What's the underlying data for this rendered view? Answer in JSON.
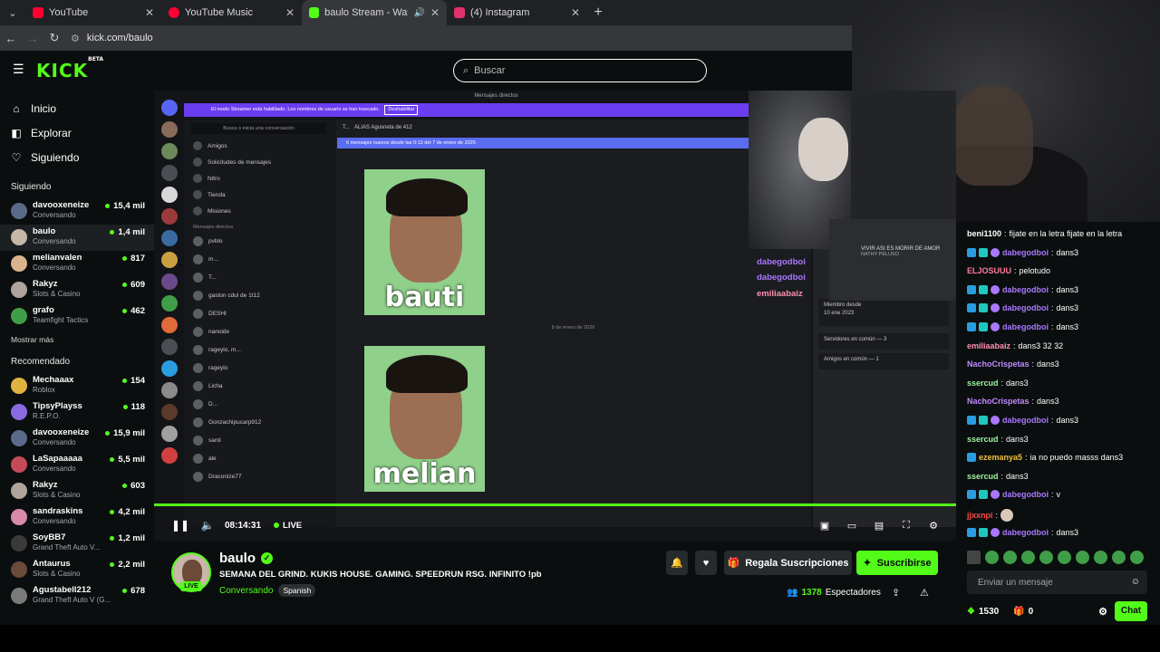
{
  "browser": {
    "tabs": [
      {
        "title": "YouTube",
        "color": "#ff0033"
      },
      {
        "title": "YouTube Music",
        "color": "#ff0033"
      },
      {
        "title": "baulo Stream - Watch Live",
        "color": "#53fc18"
      },
      {
        "title": "(4) Instagram",
        "color": "#e1306c"
      }
    ],
    "url": "kick.com/baulo"
  },
  "header": {
    "logo": "KICK",
    "logo_sup": "BETA",
    "search_placeholder": "Buscar"
  },
  "sidebar": {
    "nav": [
      {
        "label": "Inicio",
        "icon": "home-icon"
      },
      {
        "label": "Explorar",
        "icon": "compass-icon"
      },
      {
        "label": "Siguiendo",
        "icon": "heart-icon"
      }
    ],
    "following_heading": "Siguiendo",
    "following": [
      {
        "name": "davooxeneize",
        "category": "Conversando",
        "viewers": "15,4 mil",
        "color": "#5a6a8a"
      },
      {
        "name": "baulo",
        "category": "Conversando",
        "viewers": "1,4 mil",
        "color": "#c6b7a8"
      },
      {
        "name": "melianvalen",
        "category": "Conversando",
        "viewers": "817",
        "color": "#d9b38c"
      },
      {
        "name": "Rakyz",
        "category": "Slots & Casino",
        "viewers": "609",
        "color": "#b0a49a"
      },
      {
        "name": "grafo",
        "category": "Teamfight Tactics",
        "viewers": "462",
        "color": "#3f9e47"
      }
    ],
    "show_more": "Mostrar más",
    "recommended_heading": "Recomendado",
    "recommended": [
      {
        "name": "Mechaaax",
        "category": "Roblox",
        "viewers": "154",
        "color": "#e0b341"
      },
      {
        "name": "TipsyPlayss",
        "category": "R.E.P.O.",
        "viewers": "118",
        "color": "#8a6ae0"
      },
      {
        "name": "davooxeneize",
        "category": "Conversando",
        "viewers": "15,9 mil",
        "color": "#5a6a8a"
      },
      {
        "name": "LaSapaaaaa",
        "category": "Conversando",
        "viewers": "5,5 mil",
        "color": "#c44a5a"
      },
      {
        "name": "Rakyz",
        "category": "Slots & Casino",
        "viewers": "603",
        "color": "#b0a49a"
      },
      {
        "name": "sandraskins",
        "category": "Conversando",
        "viewers": "4,2 mil",
        "color": "#d88aa8"
      },
      {
        "name": "SoyBB7",
        "category": "Grand Theft Auto V...",
        "viewers": "1,2 mil",
        "color": "#3a3a3a"
      },
      {
        "name": "Antaurus",
        "category": "Slots & Casino",
        "viewers": "2,2 mil",
        "color": "#6a4a3a"
      },
      {
        "name": "Agustabell212",
        "category": "Grand Theft Auto V (G...",
        "viewers": "678",
        "color": "#7a7a7a"
      }
    ]
  },
  "video": {
    "dm_header": "Mensajes directos",
    "streamer_banner": "El modo Streamer está habilitado. Los nombres de usuario se han truncado.",
    "banner_button": "Deshabilitar",
    "dm_search": "Busca o inicia una conversación",
    "dm_menu": [
      "Amigos",
      "Solicitudes de mensajes",
      "Nitro",
      "Tienda",
      "Misiones"
    ],
    "dm_sub": "Mensajes directos",
    "dm_users": [
      "pvblo",
      "m...",
      "T...",
      "gaston cdul de 1t12",
      "DESHI",
      "nanoide",
      "rageylo, m...",
      "rageylo",
      "Licha",
      "D...",
      "Gonzachipucarp912",
      "santi",
      "ale",
      "Draconize77"
    ],
    "chat_top_name": "T...",
    "chat_alias": "ALIAS  Agusneta de 412",
    "new_messages": "6 mensajes nuevos desde las 0:13 del 7 de enero de 2026",
    "caption1": "bauti",
    "caption2": "melian",
    "date_sep": "8 de enero de 2026",
    "member_since_label": "Miembro desde",
    "member_since": "10 ene 2023",
    "servers_common": "Servidores en común — 3",
    "friends_common": "Amigos en común — 1",
    "overlay_chat": [
      {
        "user": "dabegodboi",
        "color": "#a878ff"
      },
      {
        "user": "dabegodboi",
        "color": "#a878ff"
      },
      {
        "user": "emiliaabaiz",
        "color": "#ff8fb0"
      }
    ],
    "now_playing": "VIVIR ASI ES MORIR DE AMOR",
    "now_playing_artist": "NATHY PELUSO",
    "time": "08:14:31",
    "live_label": "LIVE"
  },
  "stream": {
    "streamer": "baulo",
    "live_badge": "LIVE",
    "title": "SEMANA DEL GRIND. KUKIS HOUSE. GAMING. SPEEDRUN RSG. INFINITO !pb",
    "category": "Conversando",
    "language": "Spanish",
    "gift_button": "Regala Suscripciones",
    "subscribe_button": "Suscribirse",
    "viewers_count": "1378",
    "viewers_label": "Espectadores"
  },
  "chat": {
    "messages": [
      {
        "user": "beni1100",
        "color": "#ffffff",
        "text": "fijate en la letra fijate en la letra",
        "badges": []
      },
      {
        "user": "dabegodboi",
        "color": "#a878ff",
        "text": "dans3",
        "badges": [
          "b-blue",
          "b-teal",
          "b-purple"
        ]
      },
      {
        "user": "ELJOSUUU",
        "color": "#ff7a9c",
        "text": "pelotudo",
        "badges": []
      },
      {
        "user": "dabegodboi",
        "color": "#a878ff",
        "text": "dans3",
        "badges": [
          "b-blue",
          "b-teal",
          "b-purple"
        ]
      },
      {
        "user": "dabegodboi",
        "color": "#a878ff",
        "text": "dans3",
        "badges": [
          "b-blue",
          "b-teal",
          "b-purple"
        ]
      },
      {
        "user": "dabegodboi",
        "color": "#a878ff",
        "text": "dans3",
        "badges": [
          "b-blue",
          "b-teal",
          "b-purple"
        ]
      },
      {
        "user": "emiliaabaiz",
        "color": "#ff8fb0",
        "text": "dans3 32 32",
        "badges": []
      },
      {
        "user": "NachoCrispetas",
        "color": "#c08aff",
        "text": "dans3",
        "badges": []
      },
      {
        "user": "ssercud",
        "color": "#9ef0a0",
        "text": "dans3",
        "badges": []
      },
      {
        "user": "NachoCrispetas",
        "color": "#c08aff",
        "text": "dans3",
        "badges": []
      },
      {
        "user": "dabegodboi",
        "color": "#a878ff",
        "text": "dans3",
        "badges": [
          "b-blue",
          "b-teal",
          "b-purple"
        ]
      },
      {
        "user": "ssercud",
        "color": "#9ef0a0",
        "text": "dans3",
        "badges": []
      },
      {
        "user": "ezemanya5",
        "color": "#f0c040",
        "text": "ia no puedo masss dans3",
        "badges": [
          "b-blue"
        ]
      },
      {
        "user": "ssercud",
        "color": "#9ef0a0",
        "text": "dans3",
        "badges": []
      },
      {
        "user": "dabegodboi",
        "color": "#a878ff",
        "text": "v",
        "badges": [
          "b-blue",
          "b-teal",
          "b-purple"
        ]
      },
      {
        "user": "jjxxnpi",
        "color": "#ff4a4a",
        "text": "",
        "badges": []
      },
      {
        "user": "dabegodboi",
        "color": "#a878ff",
        "text": "dans3",
        "badges": [
          "b-blue",
          "b-teal",
          "b-purple"
        ]
      }
    ],
    "input_placeholder": "Enviar un mensaje",
    "points": "1530",
    "gifts": "0",
    "chat_button": "Chat"
  }
}
